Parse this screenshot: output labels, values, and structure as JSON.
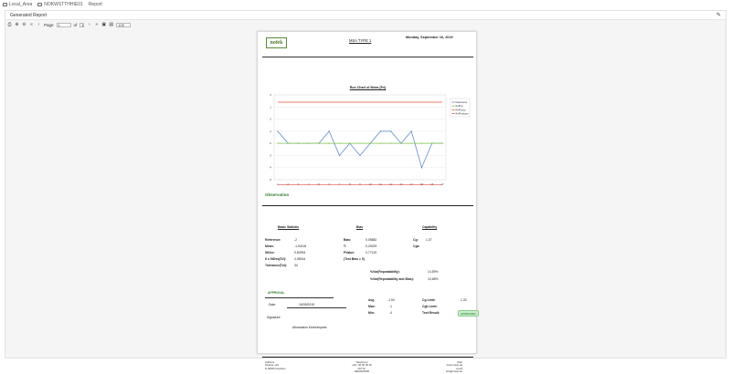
{
  "breadcrumbs": [
    "Local_Area",
    "NOKWSTTHHIE01",
    "Report"
  ],
  "panel": {
    "title": "Generated Report"
  },
  "toolbar": {
    "page_label": "Page",
    "page_value": "1",
    "of_label": "of",
    "total_pages": "1",
    "zoom": "100"
  },
  "report": {
    "logo_text": "noïek",
    "title": "MSA TYPE 1",
    "date": "Monday, September 16, 2019",
    "chart_heading": "Run Chart of Meas [Px]",
    "observation_title": "Observation",
    "sections": {
      "basic": "Basic Statistic",
      "bias": "Bias",
      "capability": "Capability"
    },
    "basic_stats": [
      {
        "label": "Reference:",
        "value": "-2"
      },
      {
        "label": "Mean:",
        "value": "-1,94118"
      },
      {
        "label": "StDev:",
        "value": "0,82994"
      },
      {
        "label": "6 x StDev(SV):",
        "value": "4,98164"
      },
      {
        "label": "Tolerance(Tol):",
        "value": "34"
      }
    ],
    "bias_stats": [
      {
        "label": "Bias:",
        "value": "0,05882"
      },
      {
        "label": "T:",
        "value": "0,29229"
      },
      {
        "label": "PValue:",
        "value": "0,77119"
      },
      {
        "label": "(Test Bias = 0)",
        "value": ""
      }
    ],
    "capability_stats": [
      {
        "label": "Cg:",
        "value": "1,37"
      },
      {
        "label": "Cgk:",
        "value": ""
      }
    ],
    "var_repeatability_label": "%Var(Repeatability):",
    "var_repeatability_value": "14,59%",
    "var_rep_bias_label": "%Var(Repeatability and Bias):",
    "var_rep_bias_value": "14,68%",
    "approval_title": "APPROVAL",
    "date_label": "Date:",
    "date_value": "16/09/2019",
    "avg_stats": [
      {
        "label": "Avg.",
        "value": "-1,94"
      },
      {
        "label": "Max:",
        "value": "-1"
      },
      {
        "label": "Min:",
        "value": "-4"
      }
    ],
    "limits": [
      {
        "label": "Cg Limit:",
        "value": "1,33"
      },
      {
        "label": "Cgk Limit:",
        "value": ""
      },
      {
        "label": "Test Result:",
        "value": ""
      }
    ],
    "test_result": "APPROVED",
    "signature_label": "Signature:",
    "signature_name": "Athanasios Kechrimparis",
    "footer": {
      "col1": [
        "Address",
        "Strasse 123",
        "D-00000 Nowhere"
      ],
      "col2": [
        "Telephone",
        "+49 / 00 00 00 00",
        "VAT Nr.",
        "DE00000000"
      ],
      "col3": [
        "Web",
        "www.noiek.de",
        "email",
        "info@noiek.de"
      ]
    }
  },
  "chart_data": {
    "type": "line",
    "title": "Run Chart of Meas [Px]",
    "x": [
      1,
      2,
      3,
      4,
      5,
      6,
      7,
      8,
      9,
      10,
      11,
      12,
      13,
      14,
      15,
      16,
      17
    ],
    "ylim": [
      -5,
      2
    ],
    "yticks": [
      2,
      1,
      0,
      -1,
      -2,
      -3,
      -4,
      -5
    ],
    "series": [
      {
        "name": "Datenwerte",
        "color": "#4f7fc8",
        "values": [
          -1,
          -2,
          -2,
          -2,
          -2,
          -1,
          -3,
          -2,
          -3,
          -2,
          -1,
          -1,
          -2,
          -1,
          -4,
          -2,
          -2
        ]
      },
      {
        "name": "RefPos",
        "color": "#7cc04a",
        "values": [
          -2,
          -2,
          -2,
          -2,
          -2,
          -2,
          -2,
          -2,
          -2,
          -2,
          -2,
          -2,
          -2,
          -2,
          -2,
          -2,
          -2
        ]
      },
      {
        "name": "RefPosup",
        "color": "#e05040",
        "values": [
          1.4,
          1.4,
          1.4,
          1.4,
          1.4,
          1.4,
          1.4,
          1.4,
          1.4,
          1.4,
          1.4,
          1.4,
          1.4,
          1.4,
          1.4,
          1.4,
          1.4
        ]
      },
      {
        "name": "RefPosdown",
        "color": "#e05040",
        "values": [
          -5.4,
          -5.4,
          -5.4,
          -5.4,
          -5.4,
          -5.4,
          -5.4,
          -5.4,
          -5.4,
          -5.4,
          -5.4,
          -5.4,
          -5.4,
          -5.4,
          -5.4,
          -5.4,
          -5.4
        ]
      }
    ]
  }
}
